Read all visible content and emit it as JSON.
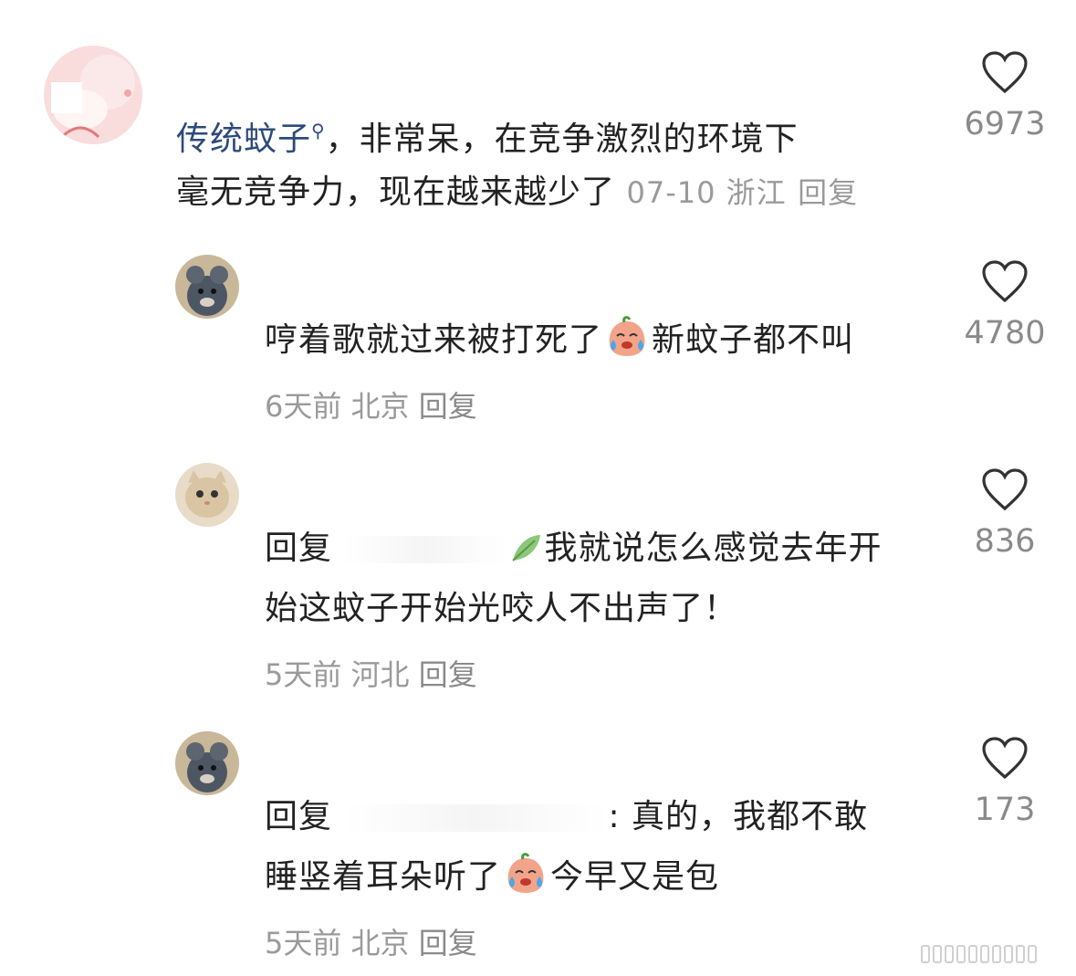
{
  "comments": [
    {
      "username": "传统蚊子",
      "text_line1": "，非常呆，在竞争激烈的环境下",
      "text_line2": "毫无竞争力，现在越来越少了",
      "meta": "07-10 浙江",
      "reply": "回复",
      "likes": "6973"
    },
    {
      "text_line1a": "哼着歌就过来被打死了",
      "text_line1b": "新蚊子都不叫",
      "meta": "6天前 北京",
      "reply": "回复",
      "likes": "4780"
    },
    {
      "reply_prefix": "回复",
      "text_line1": "我就说怎么感觉去年开",
      "text_line2": "始这蚊子开始光咬人不出声了！",
      "meta": "5天前 河北",
      "reply": "回复",
      "likes": "836"
    },
    {
      "reply_prefix": "回复",
      "text_line1": ": 真的，我都不敢",
      "text_line2a": "睡竖着耳朵听了",
      "text_line2b": "今早又是包",
      "meta": "5天前 北京",
      "reply": "回复",
      "likes": "173"
    }
  ],
  "colors": {
    "username": "#2d4a7a",
    "meta": "#9a9a9a",
    "text": "#222222"
  }
}
